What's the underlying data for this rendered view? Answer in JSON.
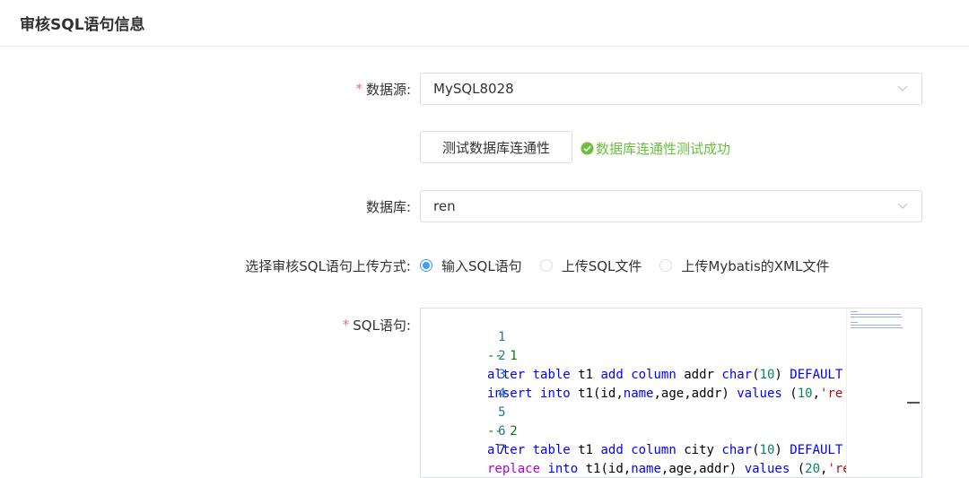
{
  "header": {
    "title": "审核SQL语句信息"
  },
  "form": {
    "datasource": {
      "label": "数据源:",
      "value": "MySQL8028"
    },
    "test_button": {
      "label": "测试数据库连通性"
    },
    "test_result": {
      "text": "数据库连通性测试成功",
      "color": "#67c23a"
    },
    "database": {
      "label": "数据库:",
      "value": "ren"
    },
    "upload_mode": {
      "label": "选择审核SQL语句上传方式:",
      "options": [
        {
          "label": "输入SQL语句",
          "checked": true
        },
        {
          "label": "上传SQL文件",
          "checked": false
        },
        {
          "label": "上传Mybatis的XML文件",
          "checked": false
        }
      ]
    },
    "sql": {
      "label": "SQL语句:",
      "lines": [
        {
          "n": "1",
          "text": "-- 1"
        },
        {
          "n": "2",
          "text": "alter table t1 add column addr char(10) DEFAULT"
        },
        {
          "n": "3",
          "text": "insert into t1(id,name,age,addr) values (10,'re"
        },
        {
          "n": "4",
          "text": ""
        },
        {
          "n": "5",
          "text": "-- 2"
        },
        {
          "n": "6",
          "text": "alter table t1 add column city char(10) DEFAULT"
        },
        {
          "n": "7",
          "text": "replace into t1(id,name,age,addr) values (20,'re"
        }
      ]
    }
  },
  "colors": {
    "accent": "#409eff",
    "required": "#f56c6c",
    "success": "#67c23a"
  }
}
